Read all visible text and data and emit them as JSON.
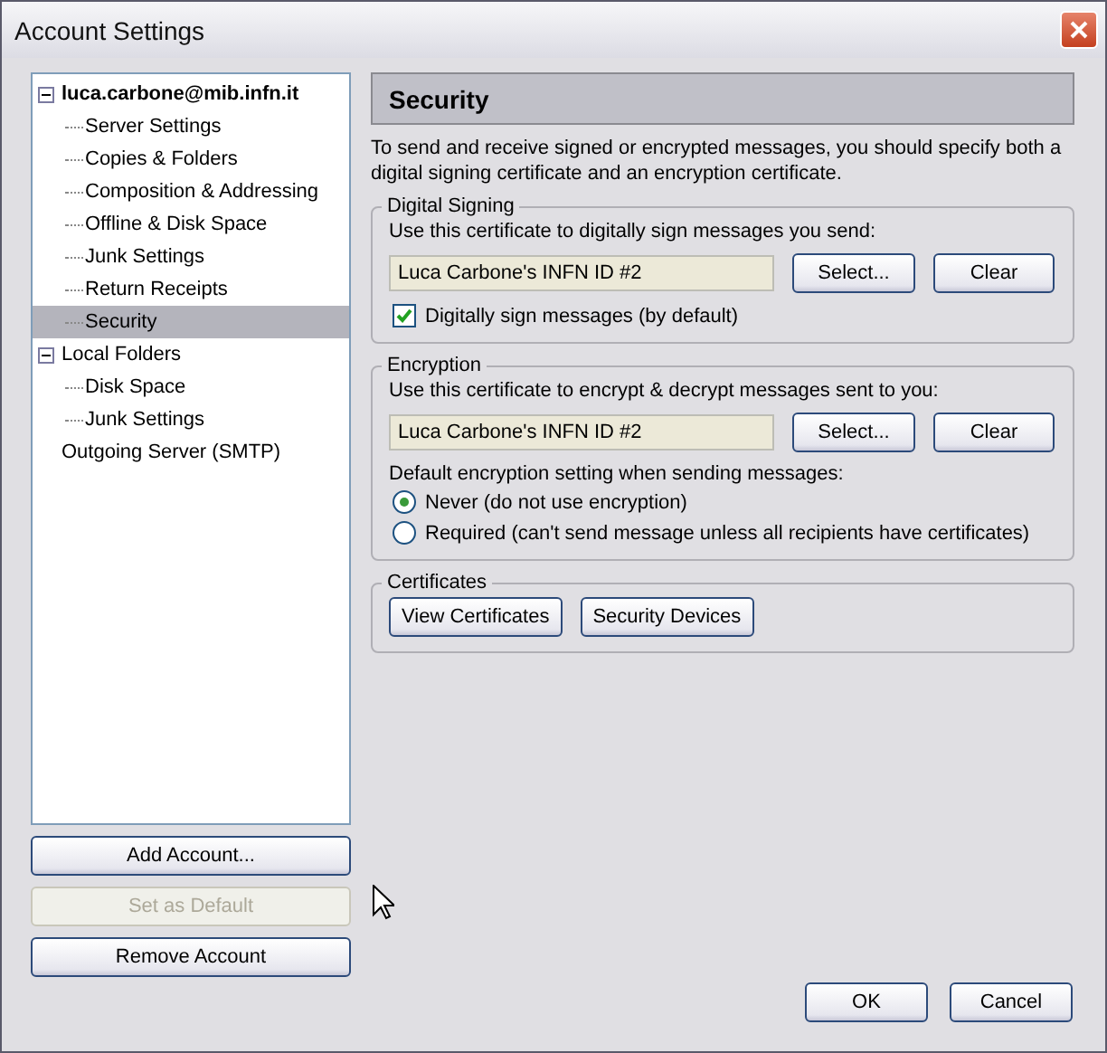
{
  "window": {
    "title": "Account Settings"
  },
  "tree": [
    {
      "label": "luca.carbone@mib.infn.it",
      "bold": true,
      "expanded": true,
      "selected": false,
      "children": [
        {
          "label": "Server Settings",
          "selected": false
        },
        {
          "label": "Copies & Folders",
          "selected": false
        },
        {
          "label": "Composition & Addressing",
          "selected": false
        },
        {
          "label": "Offline & Disk Space",
          "selected": false
        },
        {
          "label": "Junk Settings",
          "selected": false
        },
        {
          "label": "Return Receipts",
          "selected": false
        },
        {
          "label": "Security",
          "selected": true
        }
      ]
    },
    {
      "label": "Local Folders",
      "bold": false,
      "expanded": true,
      "selected": false,
      "children": [
        {
          "label": "Disk Space",
          "selected": false
        },
        {
          "label": "Junk Settings",
          "selected": false
        }
      ]
    },
    {
      "label": "Outgoing Server (SMTP)",
      "bold": false,
      "selected": false
    }
  ],
  "account_buttons": [
    {
      "label": "Add Account...",
      "disabled": false
    },
    {
      "label": "Set as Default",
      "disabled": true
    },
    {
      "label": "Remove Account",
      "disabled": false
    }
  ],
  "panel": {
    "title": "Security",
    "intro": "To send and receive signed or encrypted messages, you should specify both a digital signing certificate and an encryption certificate.",
    "signing": {
      "legend": "Digital Signing",
      "prompt": "Use this certificate to digitally sign messages you send:",
      "certificate": "Luca Carbone's INFN ID #2",
      "select": "Select...",
      "clear": "Clear",
      "checkbox": {
        "label": "Digitally sign messages (by default)",
        "checked": true
      }
    },
    "encryption": {
      "legend": "Encryption",
      "prompt": "Use this certificate to encrypt & decrypt messages sent to you:",
      "certificate": "Luca Carbone's INFN ID #2",
      "select": "Select...",
      "clear": "Clear",
      "setting_label": "Default encryption setting when sending messages:",
      "options": [
        {
          "label": "Never (do not use encryption)",
          "selected": true
        },
        {
          "label": "Required (can't send message unless all recipients have certificates)",
          "selected": false
        }
      ]
    },
    "certificates": {
      "legend": "Certificates",
      "buttons": [
        "View Certificates",
        "Security Devices"
      ]
    }
  },
  "dialog_buttons": [
    "OK",
    "Cancel"
  ]
}
